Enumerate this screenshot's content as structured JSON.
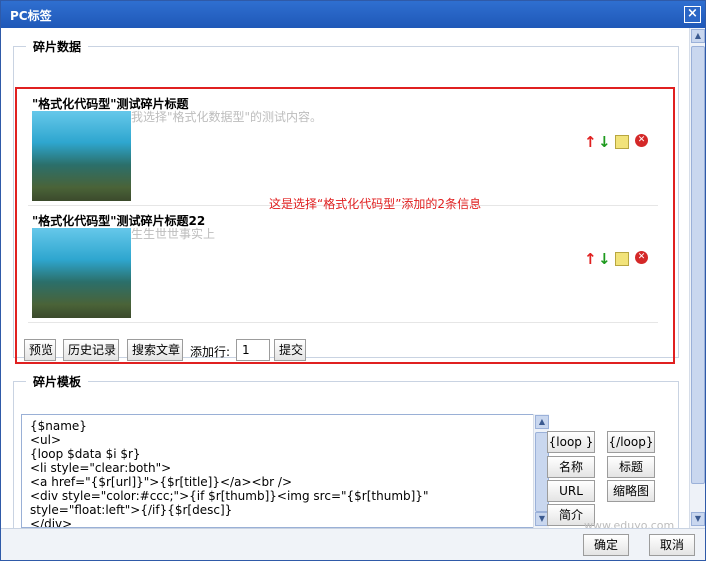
{
  "window": {
    "title": "PC标签",
    "close": "×"
  },
  "fragment_data": {
    "legend": "碎片数据",
    "items": [
      {
        "title": "\"格式化代码型\"测试碎片标题",
        "desc": "我选择\"格式化数据型\"的测试内容。"
      },
      {
        "title": "\"格式化代码型\"测试碎片标题22",
        "desc": "生生世世事实上"
      }
    ],
    "annotation": "这是选择“格式化代码型”添加的2条信息",
    "icons": {
      "up": "↑",
      "down": "↓",
      "delete": "✕"
    },
    "toolbar": {
      "preview": "预览",
      "history": "历史记录",
      "search": "搜索文章",
      "add_rows_label": "添加行:",
      "add_rows_value": "1",
      "submit": "提交"
    }
  },
  "fragment_template": {
    "legend": "碎片模板",
    "code": "{$name}\n<ul>\n{loop $data $i $r}\n<li style=\"clear:both\">\n<a href=\"{$r[url]}\">{$r[title]}</a><br />\n<div style=\"color:#ccc;\">{if $r[thumb]}<img src=\"{$r[thumb]}\"\nstyle=\"float:left\">{/if}{$r[desc]}\n</div>",
    "buttons": {
      "loop_start": "{loop }",
      "loop_end": "{/loop}",
      "name": "名称",
      "title": "标题",
      "url": "URL",
      "thumb": "缩略图",
      "desc": "简介"
    }
  },
  "footer": {
    "ok": "确定",
    "cancel": "取消"
  },
  "watermark": "www.eduyo.com"
}
